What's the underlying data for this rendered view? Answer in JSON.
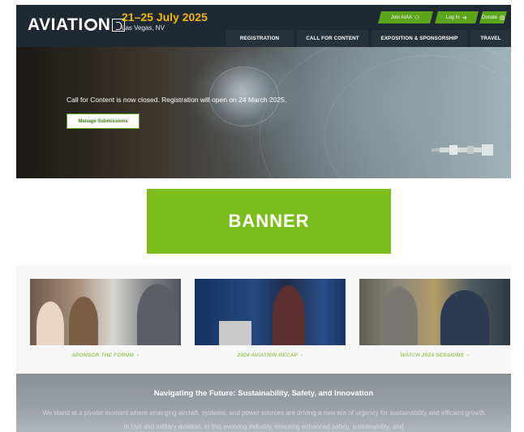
{
  "header": {
    "logo_text": "AVIATI",
    "logo_text_end": "N",
    "event_date": "21–25 July 2025",
    "event_location": "Las Vegas, NV",
    "utility": {
      "join_label": "Join AIAA",
      "login_label": "Log In",
      "donate_label": "Donate"
    },
    "nav": [
      {
        "label": "REGISTRATION"
      },
      {
        "label": "CALL FOR CONTENT"
      },
      {
        "label": "EXPOSITION & SPONSORSHIP"
      },
      {
        "label": "TRAVEL"
      }
    ]
  },
  "hero": {
    "message": "Call for Content is now closed. Registration will open on 24 March 2025.",
    "button_label": "Manage Submissions"
  },
  "banner": {
    "text": "BANNER"
  },
  "promos": [
    {
      "label": "SPONSOR THE FORUM"
    },
    {
      "label": "2024 AVIATION RECAP"
    },
    {
      "label": "WATCH 2024 SESSIONS"
    }
  ],
  "intro": {
    "title": "Navigating the Future: Sustainability, Safety, and Innovation",
    "paragraph": "We stand at a pivotal moment where emerging aircraft, systems, and power sources are driving a new era of urgency for sustainability and efficient growth in civil and military aviation. In this evolving industry, ensuring enhanced safety, sustainability, and"
  },
  "colors": {
    "header_bg": "#1f2933",
    "accent_green": "#5aa51a",
    "banner_green": "#7bbd1a",
    "date_yellow": "#f2b705",
    "promo_link": "#96c95a"
  },
  "icons": [
    "users-icon",
    "login-icon",
    "donate-icon",
    "chevron-right-icon"
  ]
}
